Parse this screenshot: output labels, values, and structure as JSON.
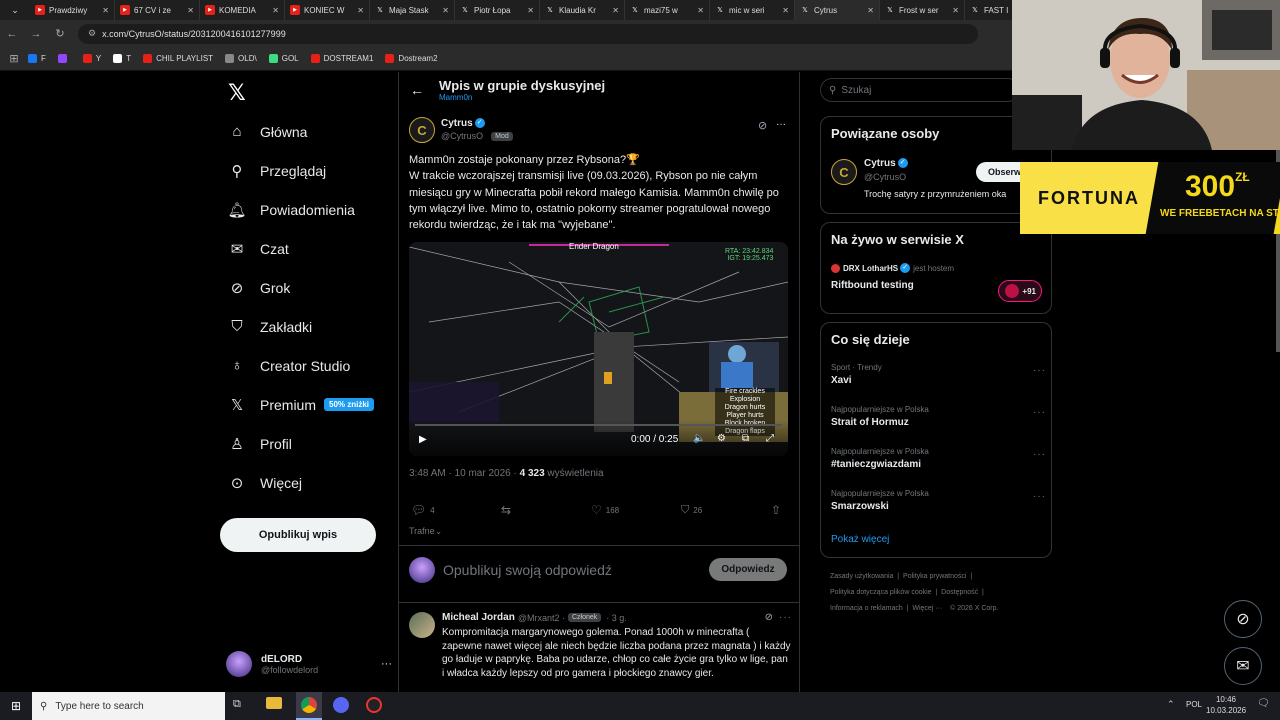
{
  "browser": {
    "tabs": [
      {
        "title": "Prawdziwy",
        "icon_color": "#e62117"
      },
      {
        "title": "67 CV i ze",
        "icon_color": "#e62117"
      },
      {
        "title": "KOMEDIA",
        "icon_color": "#e62117"
      },
      {
        "title": "KONIEC W",
        "icon_color": "#e62117"
      },
      {
        "title": "Maja Stask",
        "icon": "x-icon"
      },
      {
        "title": "Piotr Łopa",
        "icon": "x-icon"
      },
      {
        "title": "Klaudia Kr",
        "icon": "x-icon"
      },
      {
        "title": "mazi75 w",
        "icon": "x-icon"
      },
      {
        "title": "mic w seri",
        "icon": "x-icon"
      },
      {
        "title": "Cytrus",
        "icon": "x-icon",
        "active": true
      },
      {
        "title": "Frost w ser",
        "icon": "x-icon"
      },
      {
        "title": "FAST I",
        "icon": "x-icon"
      }
    ],
    "url": "x.com/CytrusO/status/2031200416101277999",
    "bookmarks": [
      {
        "label": "F",
        "color": "#1877f2"
      },
      {
        "label": "",
        "color": "#9146ff"
      },
      {
        "label": "Y",
        "color": "#e62117"
      },
      {
        "label": "T",
        "color": "#ffffff"
      },
      {
        "label": "CHIL PLAYLIST",
        "color": "#e62117"
      },
      {
        "label": "OLD\\",
        "color": "#888888"
      },
      {
        "label": "GOL",
        "color": "#3ddc84"
      },
      {
        "label": "DOSTREAM1",
        "color": "#e62117"
      },
      {
        "label": "Dostream2",
        "color": "#e62117"
      }
    ]
  },
  "nav": {
    "items": [
      {
        "label": "Główna",
        "icon": "home-icon"
      },
      {
        "label": "Przeglądaj",
        "icon": "search-icon"
      },
      {
        "label": "Powiadomienia",
        "icon": "bell-icon"
      },
      {
        "label": "Czat",
        "icon": "mail-icon"
      },
      {
        "label": "Grok",
        "icon": "grok-icon"
      },
      {
        "label": "Zakładki",
        "icon": "bookmark-icon"
      },
      {
        "label": "Creator Studio",
        "icon": "flask-icon"
      },
      {
        "label": "Premium",
        "icon": "x-icon",
        "badge": "50% zniżki"
      },
      {
        "label": "Profil",
        "icon": "person-icon"
      },
      {
        "label": "Więcej",
        "icon": "more-circle-icon"
      }
    ],
    "post_button": "Opublikuj wpis",
    "account": {
      "name": "dELORD",
      "handle": "@followdelord"
    }
  },
  "main": {
    "header_title": "Wpis w grupie dyskusyjnej",
    "header_subtitle": "Mamm0n",
    "tweet": {
      "author": "Cytrus",
      "handle": "@CytrusO",
      "role": "Mod",
      "text_line1": "Mamm0n zostaje pokonany przez Rybsona?🏆",
      "text_body": "W trakcie wczorajszej transmisji live (09.03.2026), Rybson po nie całym miesiącu gry w Minecrafta pobił rekord małego Kamisia. Mamm0n chwilę po tym włączył  live. Mimo to, ostatnio pokorny streamer pogratulował nowego rekordu twierdząc, że i tak ma \"wyjebane\".",
      "video": {
        "boss": "Ender Dragon",
        "rta": "RTA: 23:42.834",
        "igt": "IGT: 19:25.473",
        "captions": [
          "Fire crackles",
          "Explosion",
          "Dragon hurts",
          "Player hurts",
          "Block broken",
          "Dragon flaps"
        ],
        "time": "0:00 / 0:25",
        "progress": 0
      },
      "timestamp": "3:48 AM · 10 mar 2026 · ",
      "views_count": "4 323",
      "views_label": " wyświetlenia",
      "replies": "4",
      "likes": "168",
      "bookmarks": "26"
    },
    "sort_label": "Trafne",
    "reply_placeholder": "Opublikuj swoją odpowiedź",
    "reply_button": "Odpowiedz",
    "reply": {
      "author": "Micheal Jordan",
      "handle": "@Mrxant2 · ",
      "role": "Członek",
      "time": "· 3 g.",
      "text": "Kompromitacja margarynowego golema. Ponad 1000h w minecrafta ( zapewne nawet więcej ale niech będzie liczba podana przez magnata ) i każdy go ładuje w paprykę. Baba po udarze, chłop co całe życie gra tylko w lige, pan i władca każdy lepszy od pro gamera i płockiego znawcy gier."
    }
  },
  "right": {
    "search_placeholder": "Szukaj",
    "related": {
      "title": "Powiązane osoby",
      "name": "Cytrus",
      "handle": "@CytrusO",
      "bio": "Trochę satyry z przymrużeniem oka",
      "follow": "Obserw"
    },
    "live": {
      "title": "Na żywo w serwisie X",
      "host": "DRX LotharHS",
      "host_suffix": "jest hostem",
      "topic": "Riftbound testing",
      "count": "+91"
    },
    "trends": {
      "title": "Co się dzieje",
      "items": [
        {
          "meta": "Sport · Trendy",
          "name": "Xavi"
        },
        {
          "meta": "Najpopularniejsze w Polska",
          "name": "Strait of Hormuz"
        },
        {
          "meta": "Najpopularniejsze w Polska",
          "name": "#tanieczgwiazdami"
        },
        {
          "meta": "Najpopularniejsze w Polska",
          "name": "Smarzowski"
        }
      ],
      "show_more": "Pokaż więcej"
    },
    "footer": {
      "l1a": "Zasady użytkowania",
      "l1b": "Polityka prywatności",
      "l2a": "Polityka dotycząca plików cookie",
      "l2b": "Dostępność",
      "l3a": "Informacja o reklamach",
      "l3b": "Więcej ···",
      "l3c": "© 2026 X Corp."
    }
  },
  "overlay": {
    "ad_brand": "FORTUNA",
    "ad_amount": "300",
    "ad_currency": "ZŁ",
    "ad_line": "WE FREEBETACH NA STAR"
  },
  "taskbar": {
    "search_placeholder": "Type here to search",
    "lang": "POL",
    "time": "10:46",
    "date": "10.03.2026"
  },
  "colors": {
    "accent": "#1d9bf0",
    "background": "#000000",
    "ad_yellow": "#f4d81a"
  }
}
